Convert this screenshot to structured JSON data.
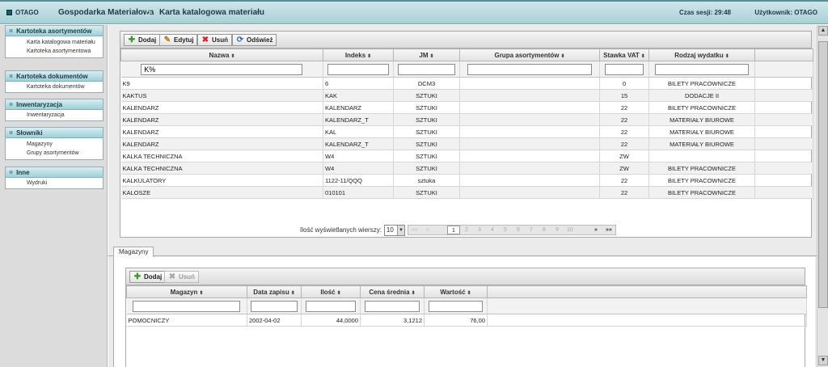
{
  "header": {
    "brand": "OTAGO",
    "module": "Gospodarka Materiałowa",
    "separator": "▷",
    "page": "Karta katalogowa materiału",
    "session_label": "Czas sesji: 29:48",
    "user_label": "Użytkownik: OTAGO"
  },
  "sidebar": {
    "panels": [
      {
        "title": "Kartoteka asortymentów",
        "items": [
          "Karta katalogowa materiału",
          "Kartoteka asortymentowa"
        ]
      },
      {
        "title": "Kartoteka dokumentów",
        "items": [
          "Kartoteka dokumentów"
        ]
      },
      {
        "title": "Inwentaryzacja",
        "items": [
          "Inwentaryzacja"
        ]
      },
      {
        "title": "Słowniki",
        "items": [
          "Magazyny",
          "Grupy asortymentów"
        ]
      },
      {
        "title": "Inne",
        "items": [
          "Wydruki"
        ]
      }
    ]
  },
  "toolbar": {
    "add": "Dodaj",
    "edit": "Edytuj",
    "delete": "Usuń",
    "refresh": "Odśwież"
  },
  "materials": {
    "columns": [
      "Nazwa",
      "Indeks",
      "JM",
      "Grupa asortymentów",
      "Stawka VAT",
      "Rodzaj wydatku"
    ],
    "filters": {
      "nazwa": "K%",
      "indeks": "",
      "jm": "",
      "grupa": "",
      "vat": "",
      "rodzaj": ""
    },
    "rows": [
      [
        "K9",
        "6",
        "DCM3",
        "",
        "0",
        "BILETY PRACOWNICZE"
      ],
      [
        "KAKTUS",
        "KAK",
        "SZTUKI",
        "",
        "15",
        "DODACJE II"
      ],
      [
        "KALENDARZ",
        "KALENDARZ",
        "SZTUKI",
        "",
        "22",
        "BILETY PRACOWNICZE"
      ],
      [
        "KALENDARZ",
        "KALENDARZ_T",
        "SZTUKI",
        "",
        "22",
        "MATERIAŁY BIUROWE"
      ],
      [
        "KALENDARZ",
        "KAL",
        "SZTUKI",
        "",
        "22",
        "MATERIAŁY BIUROWE"
      ],
      [
        "KALENDARZ",
        "KALENDARZ_T",
        "SZTUKI",
        "",
        "22",
        "MATERIAŁY BIUROWE"
      ],
      [
        "KALKA TECHNICZNA",
        "W4",
        "SZTUKI",
        "",
        "ZW",
        ""
      ],
      [
        "KALKA TECHNICZNA",
        "W4",
        "SZTUKI",
        "",
        "ZW",
        "BILETY PRACOWNICZE"
      ],
      [
        "KALKULATORY",
        "1122-11/QQQ",
        "sztuka",
        "",
        "22",
        "BILETY PRACOWNICZE"
      ],
      [
        "KALOSZE",
        "010101",
        "SZTUKI",
        "",
        "22",
        "BILETY PRACOWNICZE"
      ]
    ]
  },
  "pager": {
    "label": "Ilość wyświetlanych wierszy:",
    "page_size": "10",
    "first": "««",
    "prev": "«",
    "pages": [
      "1",
      "2",
      "3",
      "4",
      "5",
      "6",
      "7",
      "8",
      "9",
      "10"
    ],
    "current": "1",
    "next": "»",
    "last": "»»"
  },
  "tabs": {
    "magazyny": "Magazyny"
  },
  "stock": {
    "add": "Dodaj",
    "delete": "Usuń",
    "columns": [
      "Magazyn",
      "Data zapisu",
      "Ilość",
      "Cena średnia",
      "Wartość"
    ],
    "rows": [
      [
        "POMOCNICZY",
        "2002-04-02",
        "44,0000",
        "3,1212",
        "76,00"
      ]
    ]
  },
  "icons": {
    "sort": "sort-icon",
    "add": "plus-icon",
    "edit": "edit-icon",
    "delete": "delete-icon",
    "refresh": "refresh-icon"
  },
  "colors": {
    "header_bg": "#a9d0d7",
    "panel_head_bg": "#9fd0d8",
    "delete_red": "#dd2222",
    "add_green": "#3a9a2a"
  }
}
